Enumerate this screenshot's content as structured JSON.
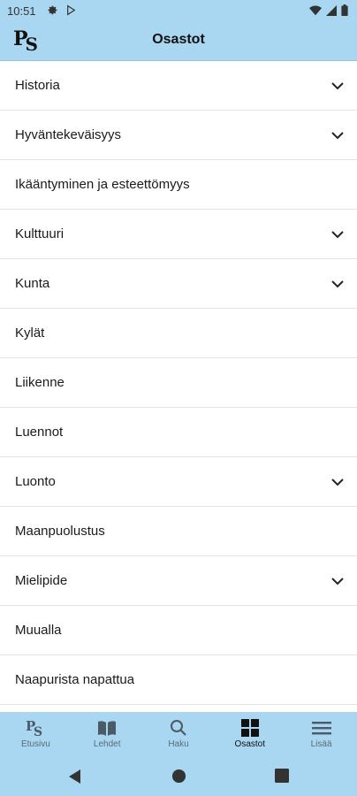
{
  "status_bar": {
    "time": "10:51"
  },
  "app_bar": {
    "logo_text": "PS",
    "title": "Osastot"
  },
  "sections": [
    {
      "label": "Historia",
      "expandable": true
    },
    {
      "label": "Hyväntekeväisyys",
      "expandable": true
    },
    {
      "label": "Ikääntyminen ja esteettömyys",
      "expandable": false
    },
    {
      "label": "Kulttuuri",
      "expandable": true
    },
    {
      "label": "Kunta",
      "expandable": true
    },
    {
      "label": "Kylät",
      "expandable": false
    },
    {
      "label": "Liikenne",
      "expandable": false
    },
    {
      "label": "Luennot",
      "expandable": false
    },
    {
      "label": "Luonto",
      "expandable": true
    },
    {
      "label": "Maanpuolustus",
      "expandable": false
    },
    {
      "label": "Mielipide",
      "expandable": true
    },
    {
      "label": "Muualla",
      "expandable": false
    },
    {
      "label": "Naapurista napattua",
      "expandable": false
    }
  ],
  "bottom_nav": [
    {
      "label": "Etusivu",
      "icon": "ps-logo-icon",
      "active": false
    },
    {
      "label": "Lehdet",
      "icon": "book-icon",
      "active": false
    },
    {
      "label": "Haku",
      "icon": "search-icon",
      "active": false
    },
    {
      "label": "Osastot",
      "icon": "grid-icon",
      "active": true
    },
    {
      "label": "Lisää",
      "icon": "menu-icon",
      "active": false
    }
  ],
  "colors": {
    "bar_background": "#a9d6f0",
    "divider": "#e2e2e2",
    "inactive_nav": "#5a6b78"
  }
}
